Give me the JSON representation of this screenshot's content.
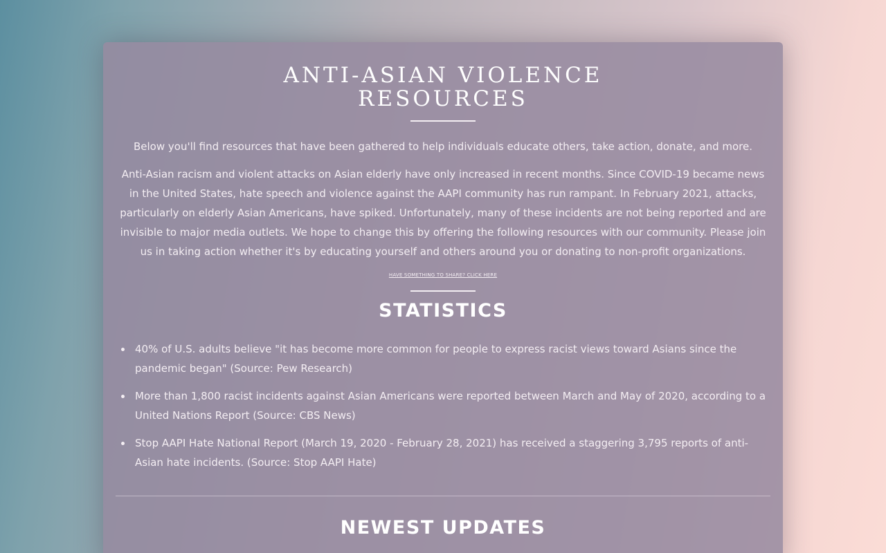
{
  "header": {
    "title_line1": "ANTI-ASIAN VIOLENCE",
    "title_line2": "RESOURCES"
  },
  "intro": {
    "lead": "Below you'll find resources that have been gathered to help individuals educate others, take action, donate, and more.",
    "paragraph": "Anti-Asian racism and violent attacks on Asian elderly have only increased in recent months. Since COVID-19 became news in the United States, hate speech and violence against the AAPI community has run rampant. In February 2021, attacks, particularly on elderly Asian Americans, have spiked. Unfortunately, many of these incidents are not being reported and are invisible to major media outlets. We hope to change this by offering the following resources with our community. Please join us in taking action whether it's by educating yourself and others around you or donating to non-profit organizations.",
    "share_link": "HAVE SOMETHING TO SHARE? CLICK HERE"
  },
  "statistics": {
    "title": "STATISTICS",
    "items": [
      "40% of U.S. adults believe \"it has become more common for people to express racist views toward Asians since the pandemic began\" (Source: Pew Research)",
      "More than 1,800 racist incidents against Asian Americans were reported between March and May of 2020, according to a United Nations Report (Source: CBS News)",
      "Stop AAPI Hate National Report (March 19, 2020 - February 28, 2021) has received a staggering 3,795 reports of anti-Asian hate incidents. (Source: Stop AAPI Hate)"
    ]
  },
  "updates": {
    "title": "NEWEST UPDATES"
  }
}
